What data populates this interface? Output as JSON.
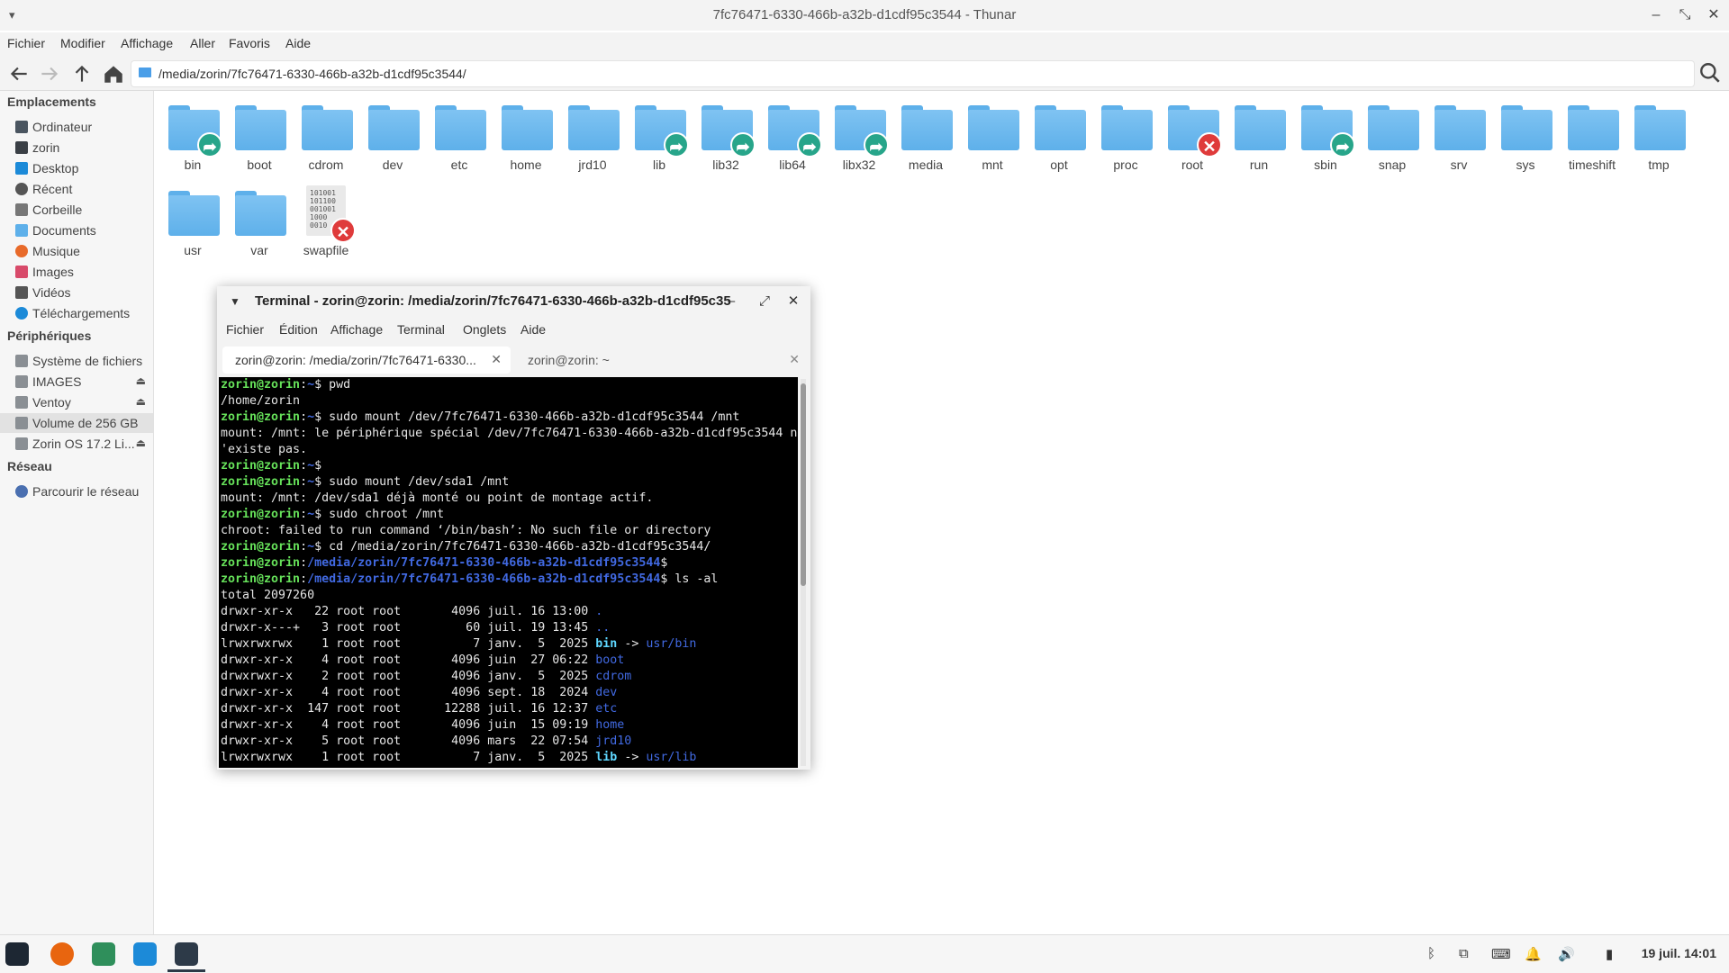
{
  "window": {
    "title": "7fc76471-6330-466b-a32b-d1cdf95c3544 - Thunar",
    "menu": [
      "Fichier",
      "Modifier",
      "Affichage",
      "Aller",
      "Favoris",
      "Aide"
    ],
    "path": "/media/zorin/7fc76471-6330-466b-a32b-d1cdf95c3544/"
  },
  "sidebar": {
    "sections": [
      {
        "title": "Emplacements",
        "items": [
          {
            "label": "Ordinateur",
            "icon": "computer-icon"
          },
          {
            "label": "zorin",
            "icon": "home-icon"
          },
          {
            "label": "Desktop",
            "icon": "desktop-icon"
          },
          {
            "label": "Récent",
            "icon": "clock-icon"
          },
          {
            "label": "Corbeille",
            "icon": "trash-icon"
          },
          {
            "label": "Documents",
            "icon": "documents-icon"
          },
          {
            "label": "Musique",
            "icon": "music-icon"
          },
          {
            "label": "Images",
            "icon": "images-icon"
          },
          {
            "label": "Vidéos",
            "icon": "video-icon"
          },
          {
            "label": "Téléchargements",
            "icon": "download-icon"
          }
        ]
      },
      {
        "title": "Périphériques",
        "items": [
          {
            "label": "Système de fichiers",
            "icon": "drive-icon"
          },
          {
            "label": "IMAGES",
            "icon": "drive-icon",
            "eject": true
          },
          {
            "label": "Ventoy",
            "icon": "drive-icon",
            "eject": true
          },
          {
            "label": "Volume de 256 GB",
            "icon": "drive-icon",
            "selected": true
          },
          {
            "label": "Zorin OS 17.2 Li...",
            "icon": "drive-icon",
            "eject": true
          }
        ]
      },
      {
        "title": "Réseau",
        "items": [
          {
            "label": "Parcourir le réseau",
            "icon": "network-icon"
          }
        ]
      }
    ]
  },
  "files": [
    {
      "name": "bin",
      "emblem": "link"
    },
    {
      "name": "boot"
    },
    {
      "name": "cdrom"
    },
    {
      "name": "dev"
    },
    {
      "name": "etc"
    },
    {
      "name": "home"
    },
    {
      "name": "jrd10"
    },
    {
      "name": "lib",
      "emblem": "link"
    },
    {
      "name": "lib32",
      "emblem": "link"
    },
    {
      "name": "lib64",
      "emblem": "link"
    },
    {
      "name": "libx32",
      "emblem": "link"
    },
    {
      "name": "media"
    },
    {
      "name": "mnt"
    },
    {
      "name": "opt"
    },
    {
      "name": "proc"
    },
    {
      "name": "root",
      "emblem": "err"
    },
    {
      "name": "run"
    },
    {
      "name": "sbin",
      "emblem": "link"
    },
    {
      "name": "snap"
    },
    {
      "name": "srv"
    },
    {
      "name": "sys"
    },
    {
      "name": "timeshift"
    },
    {
      "name": "tmp"
    },
    {
      "name": "usr"
    },
    {
      "name": "var"
    },
    {
      "name": "swapfile",
      "emblem": "err",
      "binary": true,
      "binary_text": "101001\n101100\n001001\n1000\n0010"
    }
  ],
  "terminal": {
    "title": "Terminal - zorin@zorin: /media/zorin/7fc76471-6330-466b-a32b-d1cdf95c35",
    "menu": [
      "Fichier",
      "Édition",
      "Affichage",
      "Terminal",
      "Onglets",
      "Aide"
    ],
    "tabs": [
      {
        "label": "zorin@zorin: /media/zorin/7fc76471-6330...",
        "active": true
      },
      {
        "label": "zorin@zorin: ~",
        "active": false
      }
    ],
    "lines": [
      [
        [
          "pu",
          "zorin@zorin"
        ],
        [
          "",
          "​:"
        ],
        [
          "pp",
          "~"
        ],
        [
          "",
          "$ pwd"
        ]
      ],
      [
        [
          "",
          "/home/zorin"
        ]
      ],
      [
        [
          "pu",
          "zorin@zorin"
        ],
        [
          "",
          ":"
        ],
        [
          "pp",
          "~"
        ],
        [
          "",
          "$ sudo mount /dev/7fc76471-6330-466b-a32b-d1cdf95c3544 /mnt"
        ]
      ],
      [
        [
          "",
          "mount: /mnt: le périphérique spécial /dev/7fc76471-6330-466b-a32b-d1cdf95c3544 n"
        ]
      ],
      [
        [
          "",
          "'existe pas."
        ]
      ],
      [
        [
          "pu",
          "zorin@zorin"
        ],
        [
          "",
          ":"
        ],
        [
          "pp",
          "~"
        ],
        [
          "",
          "$"
        ]
      ],
      [
        [
          "pu",
          "zorin@zorin"
        ],
        [
          "",
          ":"
        ],
        [
          "pp",
          "~"
        ],
        [
          "",
          "$ sudo mount /dev/sda1 /mnt"
        ]
      ],
      [
        [
          "",
          "mount: /mnt: /dev/sda1 déjà monté ou point de montage actif."
        ]
      ],
      [
        [
          "pu",
          "zorin@zorin"
        ],
        [
          "",
          ":"
        ],
        [
          "pp",
          "~"
        ],
        [
          "",
          "$ sudo chroot /mnt"
        ]
      ],
      [
        [
          "",
          "chroot: failed to run command ‘/bin/bash’: No such file or directory"
        ]
      ],
      [
        [
          "pu",
          "zorin@zorin"
        ],
        [
          "",
          ":"
        ],
        [
          "pp",
          "~"
        ],
        [
          "",
          "$ cd /media/zorin/7fc76471-6330-466b-a32b-d1cdf95c3544/"
        ]
      ],
      [
        [
          "pu",
          "zorin@zorin"
        ],
        [
          "",
          ":"
        ],
        [
          "pp",
          "/media/zorin/7fc76471-6330-466b-a32b-d1cdf95c3544"
        ],
        [
          "",
          "$"
        ]
      ],
      [
        [
          "pu",
          "zorin@zorin"
        ],
        [
          "",
          ":"
        ],
        [
          "pp",
          "/media/zorin/7fc76471-6330-466b-a32b-d1cdf95c3544"
        ],
        [
          "",
          "$ ls -al"
        ]
      ],
      [
        [
          "",
          "total 2097260"
        ]
      ],
      [
        [
          "",
          "drwxr-xr-x   22 root root       4096 juil. 16 13:00 "
        ],
        [
          "dir",
          "."
        ]
      ],
      [
        [
          "",
          "drwxr-x---+   3 root root         60 juil. 19 13:45 "
        ],
        [
          "dir",
          ".."
        ]
      ],
      [
        [
          "",
          "lrwxrwxrwx    1 root root          7 janv.  5  2025 "
        ],
        [
          "lnk",
          "bin"
        ],
        [
          "",
          " -> "
        ],
        [
          "dir",
          "usr/bin"
        ]
      ],
      [
        [
          "",
          "drwxr-xr-x    4 root root       4096 juin  27 06:22 "
        ],
        [
          "dir",
          "boot"
        ]
      ],
      [
        [
          "",
          "drwxrwxr-x    2 root root       4096 janv.  5  2025 "
        ],
        [
          "dir",
          "cdrom"
        ]
      ],
      [
        [
          "",
          "drwxr-xr-x    4 root root       4096 sept. 18  2024 "
        ],
        [
          "dir",
          "dev"
        ]
      ],
      [
        [
          "",
          "drwxr-xr-x  147 root root      12288 juil. 16 12:37 "
        ],
        [
          "dir",
          "etc"
        ]
      ],
      [
        [
          "",
          "drwxr-xr-x    4 root root       4096 juin  15 09:19 "
        ],
        [
          "dir",
          "home"
        ]
      ],
      [
        [
          "",
          "drwxr-xr-x    5 root root       4096 mars  22 07:54 "
        ],
        [
          "dir",
          "jrd10"
        ]
      ],
      [
        [
          "",
          "lrwxrwxrwx    1 root root          7 janv.  5  2025 "
        ],
        [
          "lnk",
          "lib"
        ],
        [
          "",
          " -> "
        ],
        [
          "dir",
          "usr/lib"
        ]
      ]
    ]
  },
  "taskbar": {
    "apps": [
      {
        "icon": "zorin-menu-icon",
        "color": "#1d2733"
      },
      {
        "icon": "firefox-icon",
        "color": "#e8650f"
      },
      {
        "icon": "files-icon",
        "color": "#2f8f5b"
      },
      {
        "icon": "software-store-icon",
        "color": "#1c8ad8"
      },
      {
        "icon": "terminal-icon",
        "color": "#2d3a48"
      }
    ],
    "tray": [
      "bluetooth-icon",
      "network-icon",
      "keyboard-icon",
      "notifications-icon",
      "volume-icon",
      "battery-icon"
    ],
    "clock": "19 juil. 14:01"
  },
  "colors": {
    "folder": "#5eb0ea",
    "link_emblem": "#27a58a",
    "error_emblem": "#df3b3b",
    "prompt_user": "#66e15a",
    "prompt_path": "#4169e1"
  }
}
